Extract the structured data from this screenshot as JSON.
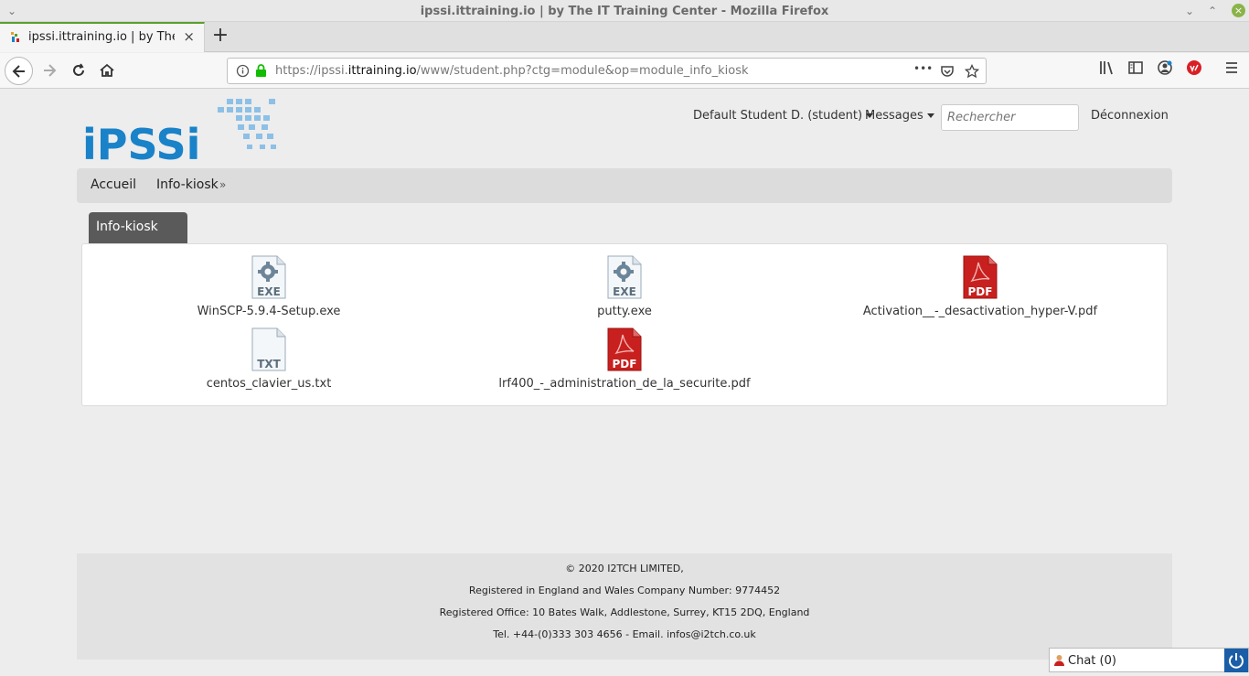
{
  "window": {
    "title": "ipssi.ittraining.io | by The IT Training Center - Mozilla Firefox",
    "close_glyph": "×"
  },
  "browser": {
    "tab_title": "ipssi.ittraining.io | by The IT",
    "tab_close": "×",
    "new_tab": "+",
    "url_prefix": "https://ipssi.",
    "url_domain": "ittraining.io",
    "url_path": "/www/student.php?ctg=module&op=module_info_kiosk",
    "url_more": "•••"
  },
  "header": {
    "logo_text": "iPSSi",
    "user_menu": "Default Student D. (student)",
    "messages_menu": "Messages",
    "search_placeholder": "Rechercher",
    "logout": "Déconnexion"
  },
  "breadcrumb": {
    "home": "Accueil",
    "separator": "»",
    "current": "Info-kiosk"
  },
  "panel": {
    "tab_label": "Info-kiosk",
    "files": [
      {
        "name": "WinSCP-5.9.4-Setup.exe",
        "type": "EXE"
      },
      {
        "name": "putty.exe",
        "type": "EXE"
      },
      {
        "name": "Activation__-_desactivation_hyper-V.pdf",
        "type": "PDF"
      },
      {
        "name": "centos_clavier_us.txt",
        "type": "TXT"
      },
      {
        "name": "lrf400_-_administration_de_la_securite.pdf",
        "type": "PDF"
      }
    ]
  },
  "footer": {
    "line1": "© 2020 I2TCH LIMITED,",
    "line2": "Registered in England and Wales Company Number: 9774452",
    "line3": "Registered Office: 10 Bates Walk, Addlestone, Surrey, KT15 2DQ, England",
    "line4": "Tel. +44-(0)333 303 4656 - Email. infos@i2tch.co.uk"
  },
  "chat": {
    "label": "Chat (0)"
  },
  "colors": {
    "brand_blue": "#1a82c8",
    "pdf_red": "#c8201e",
    "tab_dark": "#5a5a5a"
  }
}
